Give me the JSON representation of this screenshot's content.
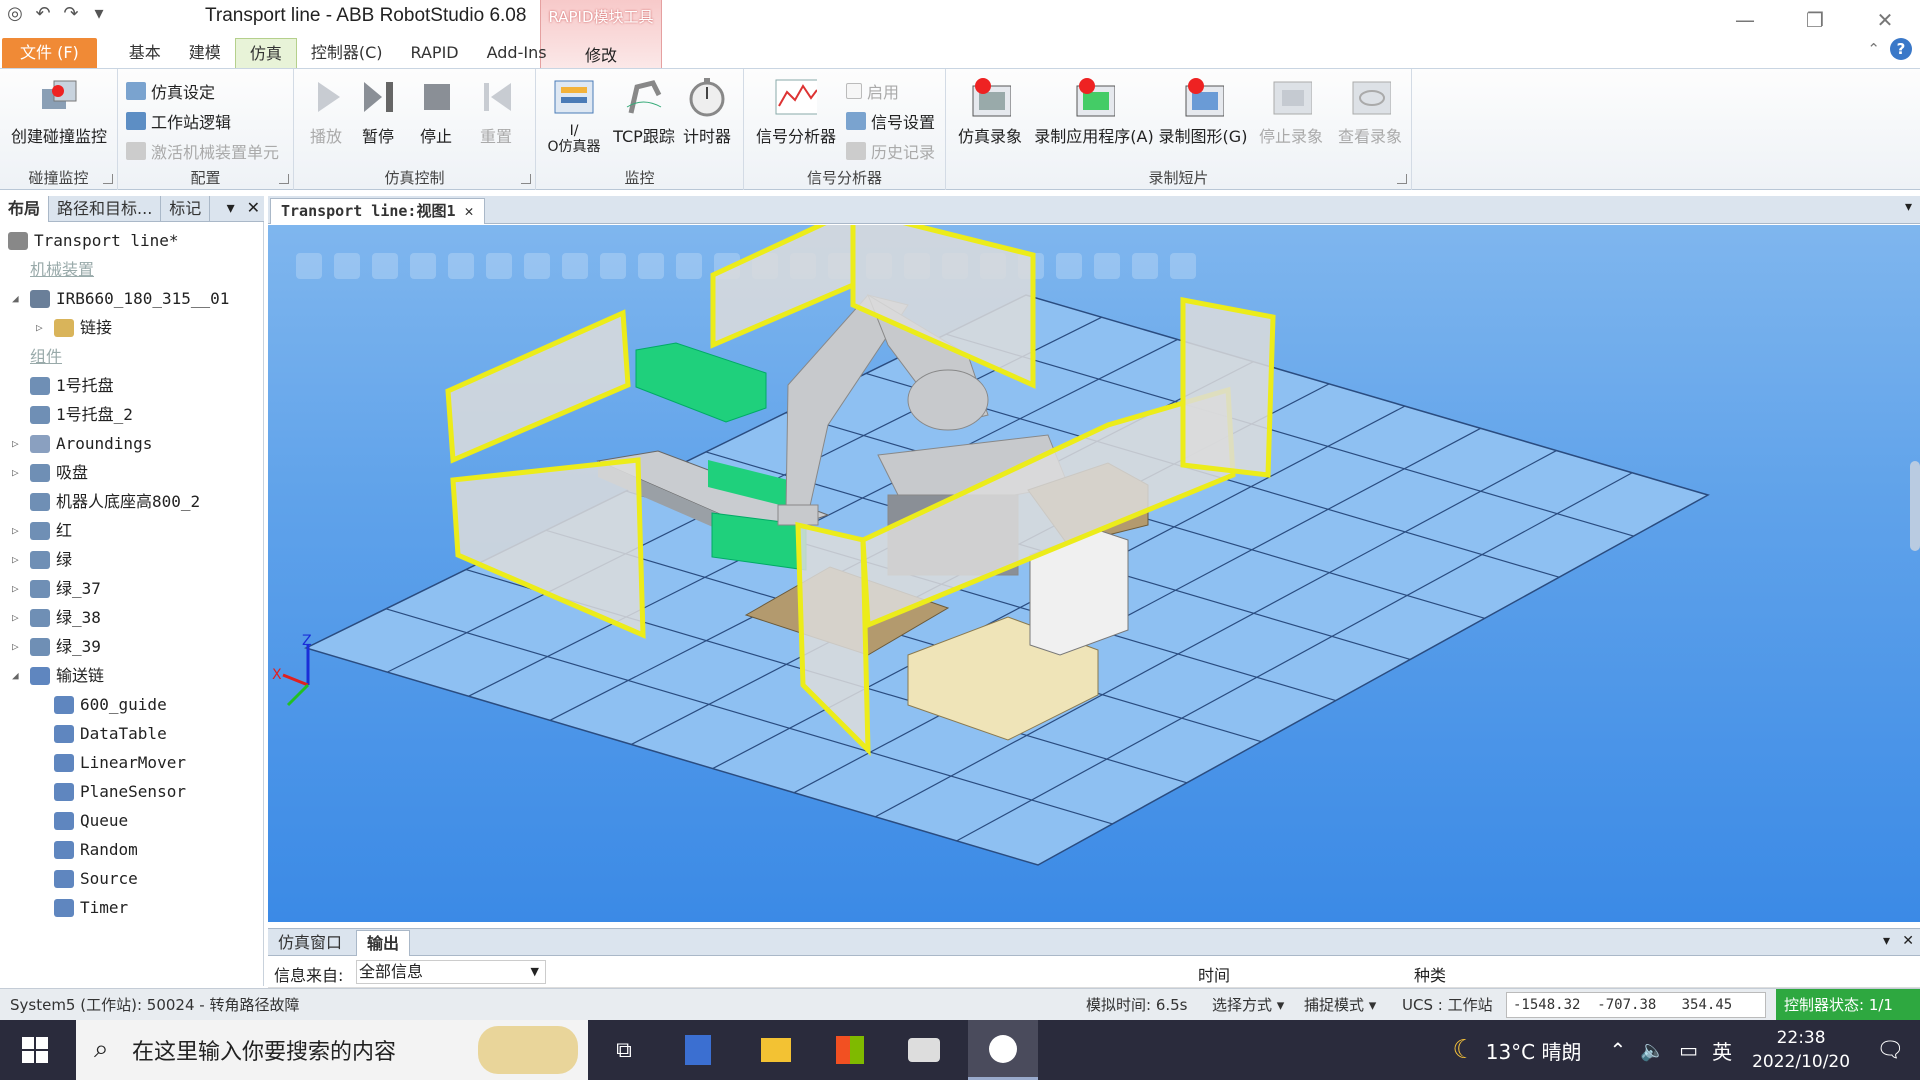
{
  "app": {
    "title": "Transport line - ABB RobotStudio 6.08",
    "context_tab_title": "RAPID模块工具",
    "context_tab_label": "修改"
  },
  "tabs": [
    "文件 (F)",
    "基本",
    "建模",
    "仿真",
    "控制器(C)",
    "RAPID",
    "Add-Ins"
  ],
  "active_tab": "仿真",
  "ribbon": {
    "collision": {
      "label": "碰撞监控",
      "create_button": "创建碰撞监控"
    },
    "config": {
      "label": "配置",
      "sim_settings": "仿真设定",
      "station_logic": "工作站逻辑",
      "activate_unit": "激活机械装置单元"
    },
    "sim_control": {
      "label": "仿真控制",
      "play": "播放",
      "pause": "暂停",
      "stop": "停止",
      "reset": "重置"
    },
    "monitor": {
      "label": "监控",
      "io_sim": "I/\nO仿真器",
      "tcp_trace": "TCP跟踪",
      "timer": "计时器"
    },
    "signal_analyzer": {
      "label": "信号分析器",
      "analyzer": "信号分析器",
      "enable": "启用",
      "signal_setup": "信号设置",
      "history": "历史记录"
    },
    "record": {
      "label": "录制短片",
      "sim_record": "仿真录象",
      "record_app": "录制应用程序(A)",
      "record_graphics": "录制图形(G)",
      "stop_record": "停止录象",
      "view_record": "查看录象"
    }
  },
  "left_panel": {
    "tabs": [
      "布局",
      "路径和目标...",
      "标记"
    ],
    "tree": [
      {
        "label": "Transport line*",
        "level": 0,
        "type": "station"
      },
      {
        "label": "机械装置",
        "level": 1,
        "type": "category"
      },
      {
        "label": "IRB660_180_315__01",
        "level": 1,
        "type": "robot",
        "expand": "open"
      },
      {
        "label": "链接",
        "level": 2,
        "type": "folder",
        "expand": "closed"
      },
      {
        "label": "组件",
        "level": 1,
        "type": "category"
      },
      {
        "label": "1号托盘",
        "level": 1,
        "type": "part"
      },
      {
        "label": "1号托盘_2",
        "level": 1,
        "type": "part"
      },
      {
        "label": "Aroundings",
        "level": 1,
        "type": "assembly",
        "expand": "closed"
      },
      {
        "label": "吸盘",
        "level": 1,
        "type": "part",
        "expand": "closed"
      },
      {
        "label": "机器人底座高800_2",
        "level": 1,
        "type": "part"
      },
      {
        "label": "红",
        "level": 1,
        "type": "part",
        "expand": "closed"
      },
      {
        "label": "绿",
        "level": 1,
        "type": "part",
        "expand": "closed"
      },
      {
        "label": "绿_37",
        "level": 1,
        "type": "part",
        "expand": "closed"
      },
      {
        "label": "绿_38",
        "level": 1,
        "type": "part",
        "expand": "closed"
      },
      {
        "label": "绿_39",
        "level": 1,
        "type": "part",
        "expand": "closed"
      },
      {
        "label": "输送链",
        "level": 1,
        "type": "smart",
        "expand": "open"
      },
      {
        "label": "600_guide",
        "level": 2,
        "type": "smart"
      },
      {
        "label": "DataTable",
        "level": 2,
        "type": "smart"
      },
      {
        "label": "LinearMover",
        "level": 2,
        "type": "smart"
      },
      {
        "label": "PlaneSensor",
        "level": 2,
        "type": "smart"
      },
      {
        "label": "Queue",
        "level": 2,
        "type": "smart"
      },
      {
        "label": "Random",
        "level": 2,
        "type": "smart"
      },
      {
        "label": "Source",
        "level": 2,
        "type": "smart"
      },
      {
        "label": "Timer",
        "level": 2,
        "type": "smart"
      }
    ]
  },
  "viewport": {
    "tab": "Transport line:视图1"
  },
  "output": {
    "tabs": [
      "仿真窗口",
      "输出"
    ],
    "source_label": "信息来自:",
    "source_value": "全部信息",
    "col_time": "时间",
    "col_type": "种类"
  },
  "status": {
    "message": "System5 (工作站): 50024 - 转角路径故障",
    "sim_time": "模拟时间: 6.5s",
    "select_mode": "选择方式",
    "snap_mode": "捕捉模式",
    "ucs": "UCS : 工作站",
    "coord_x": "-1548.32",
    "coord_y": "-707.38",
    "coord_z": "354.45",
    "controller_status": "控制器状态:  1/1"
  },
  "taskbar": {
    "search_placeholder": "在这里输入你要搜索的内容",
    "weather": "13°C  晴朗",
    "ime": "英",
    "time": "22:38",
    "date": "2022/10/20"
  },
  "colors": {
    "file_tab": "#f08a36",
    "active_tab_bg": "#e8f3d8",
    "viewport_sky": "#5fa2ea",
    "fence": "#ecec1a",
    "box_green": "#1fd07c",
    "controller_ok": "#2ea840"
  }
}
